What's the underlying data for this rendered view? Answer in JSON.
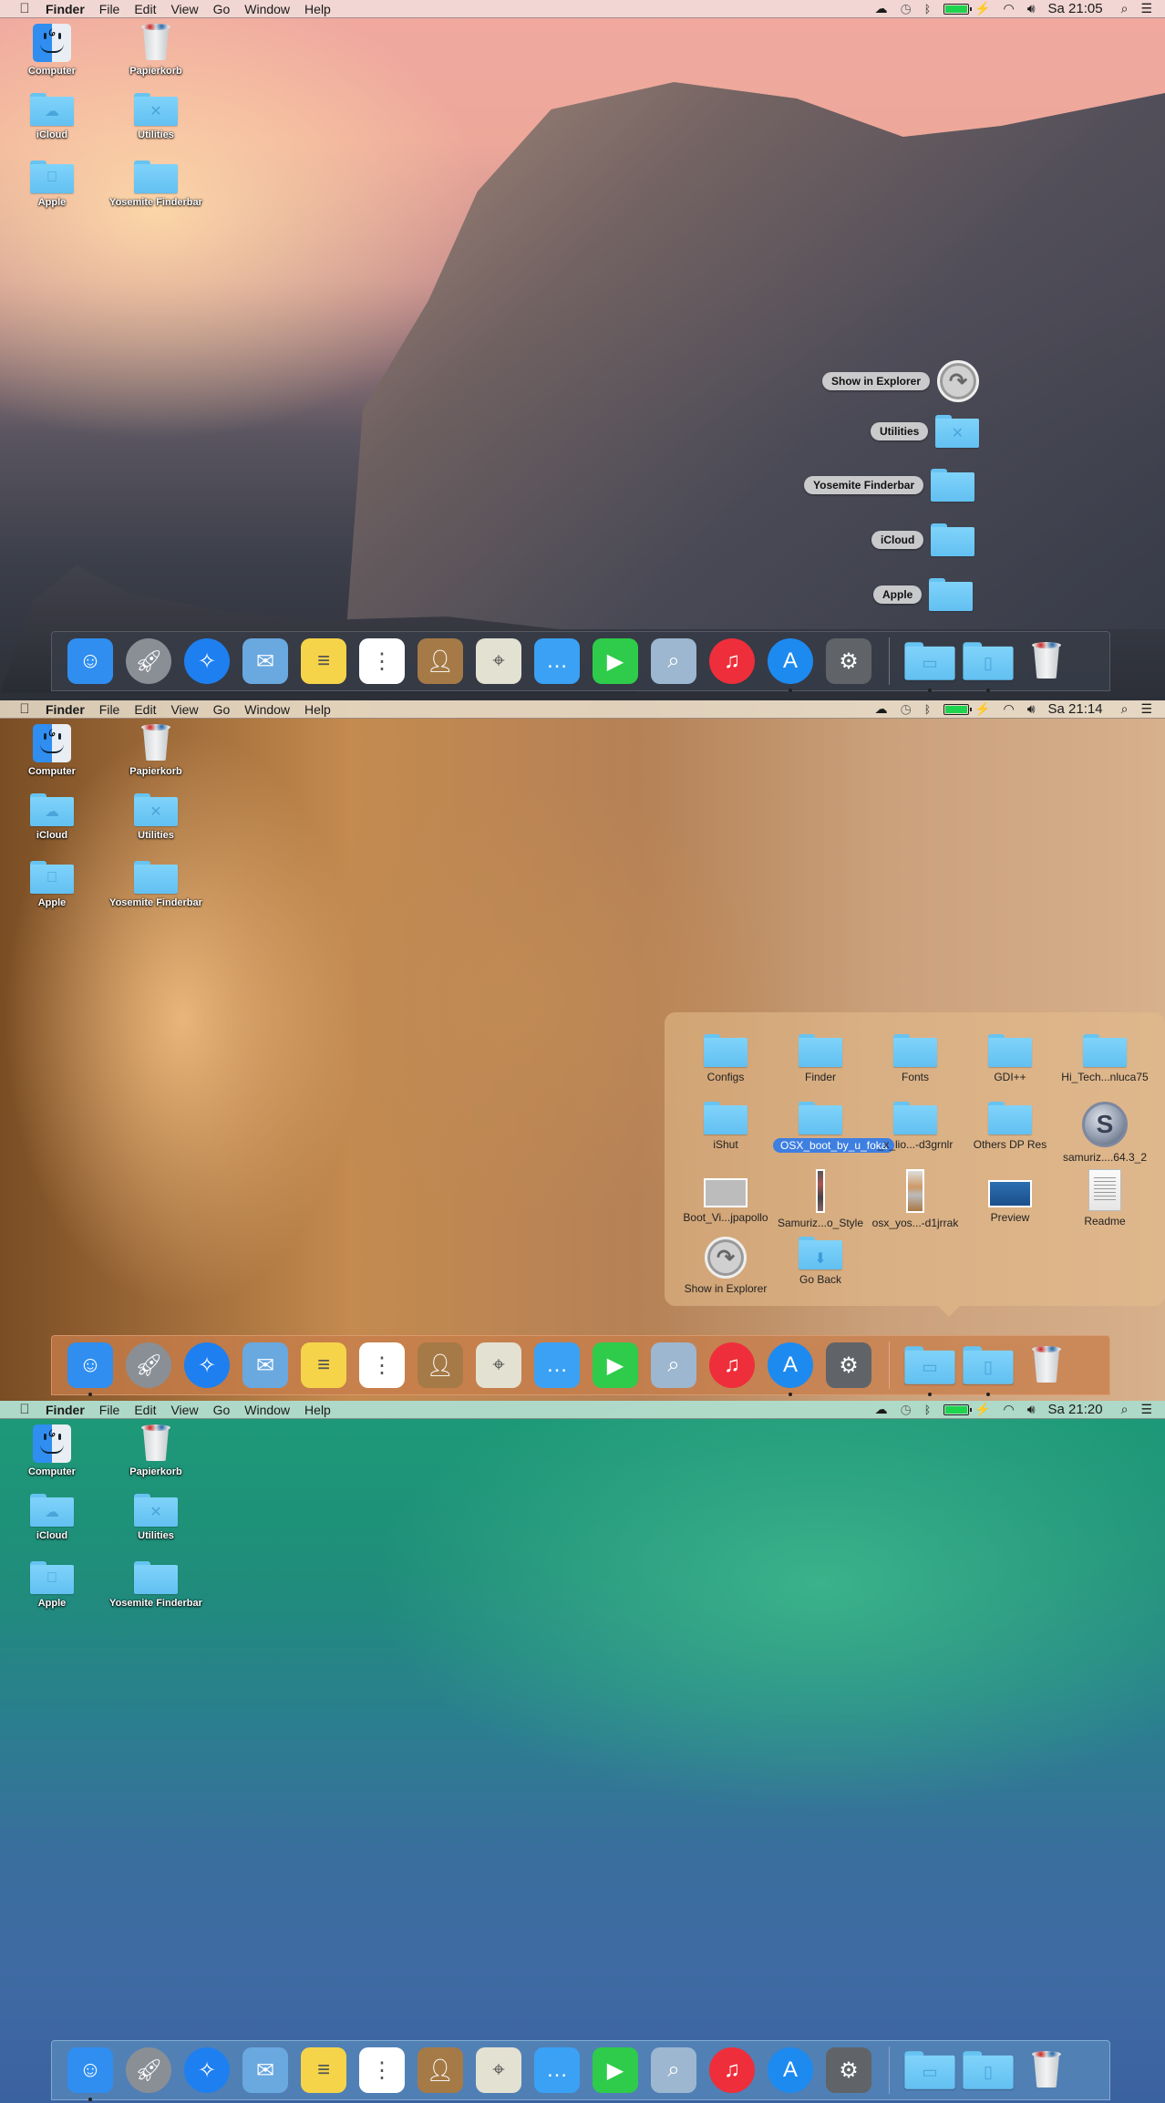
{
  "screens": [
    {
      "wallpaper": "Yosemite Half Dome",
      "menubar": {
        "apple_icon": "apple-logo",
        "app_name": "Finder",
        "menus": [
          "File",
          "Edit",
          "View",
          "Go",
          "Window",
          "Help"
        ],
        "status": {
          "icons": [
            "cloud-icon",
            "time-machine-icon",
            "bluetooth-icon",
            "battery-icon",
            "charging-bolt-icon",
            "wifi-icon",
            "volume-icon"
          ],
          "battery_level": 1.0,
          "clock": "Sa 21:05",
          "search_icon": "spotlight-icon",
          "list_icon": "notification-center-icon"
        }
      },
      "desktop_icons": [
        {
          "label": "Computer",
          "type": "finder"
        },
        {
          "label": "Papierkorb",
          "type": "trash"
        },
        {
          "label": "iCloud",
          "type": "folder",
          "glyph": "cloud"
        },
        {
          "label": "Utilities",
          "type": "folder",
          "glyph": "tools"
        },
        {
          "label": "Apple",
          "type": "folder",
          "glyph": "apple"
        },
        {
          "label": "Yosemite Finderbar",
          "type": "folder",
          "glyph": ""
        }
      ],
      "fan_stack": [
        {
          "label": "Show in Explorer",
          "icon": "show-in-explorer"
        },
        {
          "label": "Utilities",
          "icon": "folder-tools"
        },
        {
          "label": "Yosemite Finderbar",
          "icon": "folder"
        },
        {
          "label": "iCloud",
          "icon": "folder"
        },
        {
          "label": "Apple",
          "icon": "folder"
        }
      ]
    },
    {
      "wallpaper": "Lion",
      "menubar": {
        "apple_icon": "apple-logo",
        "app_name": "Finder",
        "menus": [
          "File",
          "Edit",
          "View",
          "Go",
          "Window",
          "Help"
        ],
        "status": {
          "battery_level": 1.0,
          "clock": "Sa 21:14"
        }
      },
      "desktop_icons": [
        {
          "label": "Computer"
        },
        {
          "label": "Papierkorb"
        },
        {
          "label": "iCloud"
        },
        {
          "label": "Utilities"
        },
        {
          "label": "Apple"
        },
        {
          "label": "Yosemite Finderbar"
        }
      ],
      "grid_stack": [
        {
          "label": "Configs",
          "type": "folder"
        },
        {
          "label": "Finder",
          "type": "folder"
        },
        {
          "label": "Fonts",
          "type": "folder"
        },
        {
          "label": "GDI++",
          "type": "folder"
        },
        {
          "label": "Hi_Tech...nluca75",
          "type": "folder"
        },
        {
          "label": "iShut",
          "type": "folder"
        },
        {
          "label": "OSX_boot_by_u_foka",
          "type": "folder",
          "selected": true
        },
        {
          "label": "_x_lio...-d3grnlr",
          "type": "folder"
        },
        {
          "label": "Others DP Res",
          "type": "folder"
        },
        {
          "label": "samuriz....64.3_2",
          "type": "samurize"
        },
        {
          "label": "Boot_Vi...jpapollo",
          "type": "image-wide"
        },
        {
          "label": "Samuriz...o_Style",
          "type": "image-tall"
        },
        {
          "label": "osx_yos...-d1jrrak",
          "type": "image-tall2"
        },
        {
          "label": "Preview",
          "type": "image-blue"
        },
        {
          "label": "Readme",
          "type": "document"
        },
        {
          "label": "Show in Explorer",
          "type": "show-in-explorer"
        },
        {
          "label": "Go Back",
          "type": "folder-back"
        }
      ]
    },
    {
      "wallpaper": "Mavericks Wave",
      "menubar": {
        "apple_icon": "apple-logo",
        "app_name": "Finder",
        "menus": [
          "File",
          "Edit",
          "View",
          "Go",
          "Window",
          "Help"
        ],
        "status": {
          "battery_level": 1.0,
          "clock": "Sa 21:20"
        }
      },
      "desktop_icons": [
        {
          "label": "Computer"
        },
        {
          "label": "Papierkorb"
        },
        {
          "label": "iCloud"
        },
        {
          "label": "Utilities"
        },
        {
          "label": "Apple"
        },
        {
          "label": "Yosemite Finderbar"
        }
      ]
    }
  ],
  "dock": {
    "apps": [
      {
        "name": "Finder",
        "icon": "finder-icon",
        "color": "#2f8ef0"
      },
      {
        "name": "Launchpad",
        "icon": "rocket-icon",
        "color": "#8a8f96"
      },
      {
        "name": "Safari",
        "icon": "compass-icon",
        "color": "#1e7ff0"
      },
      {
        "name": "Mail",
        "icon": "stamp-icon",
        "color": "#6aa8e0"
      },
      {
        "name": "Notes",
        "icon": "notepad-icon",
        "color": "#f6d44a"
      },
      {
        "name": "Reminders",
        "icon": "list-icon",
        "color": "#ffffff"
      },
      {
        "name": "Contacts",
        "icon": "contacts-book-icon",
        "color": "#a57a46"
      },
      {
        "name": "Maps",
        "icon": "map-icon",
        "color": "#e3e1d2"
      },
      {
        "name": "Messages",
        "icon": "speech-bubble-icon",
        "color": "#3aa1f5"
      },
      {
        "name": "FaceTime",
        "icon": "video-camera-icon",
        "color": "#2ecc4a"
      },
      {
        "name": "Preview",
        "icon": "photo-loupe-icon",
        "color": "#9cb7cf"
      },
      {
        "name": "iTunes",
        "icon": "music-note-icon",
        "color": "#ee2e3a"
      },
      {
        "name": "App Store",
        "icon": "app-store-icon",
        "color": "#1d8af0"
      },
      {
        "name": "System Preferences",
        "icon": "gear-icon",
        "color": "#606468"
      }
    ],
    "stacks": [
      {
        "name": "Applications",
        "icon": "folder-applications-icon"
      },
      {
        "name": "Documents",
        "icon": "folder-documents-icon"
      }
    ],
    "trash": {
      "name": "Trash",
      "icon": "trash-icon"
    },
    "running_dots": [
      {
        "screen": 1,
        "apps": [
          "App Store"
        ],
        "stacks": [
          "Applications",
          "Documents"
        ]
      },
      {
        "screen": 2,
        "apps": [
          "Finder",
          "App Store"
        ],
        "stacks": [
          "Applications",
          "Documents"
        ]
      },
      {
        "screen": 3,
        "apps": [
          "Finder"
        ],
        "stacks": []
      }
    ]
  }
}
